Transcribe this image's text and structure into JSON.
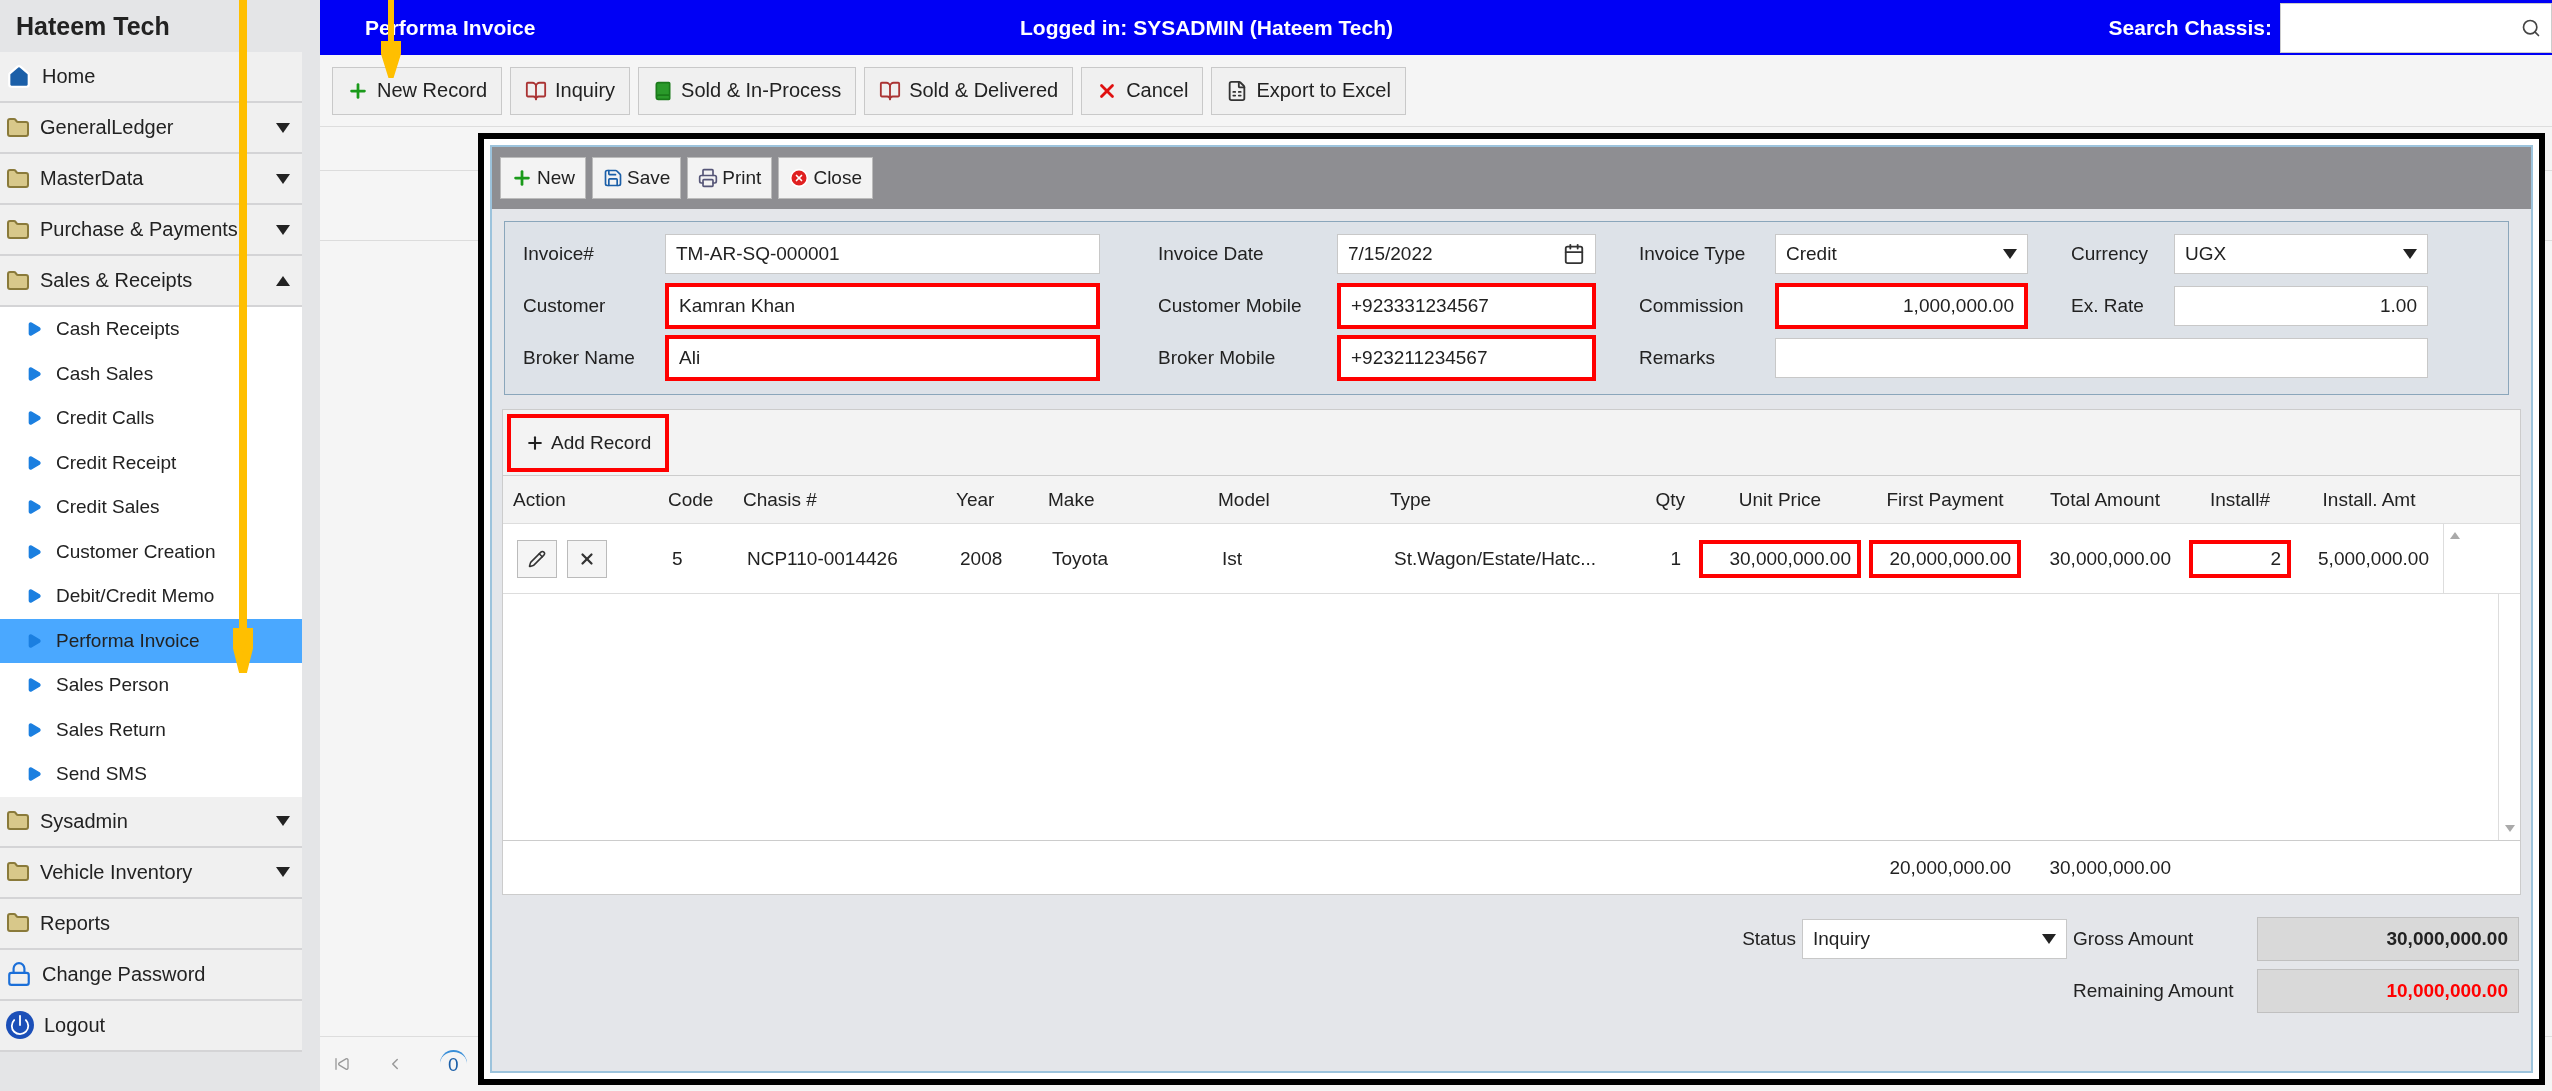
{
  "sidebar": {
    "title": "Hateem Tech",
    "items": [
      {
        "label": "Home",
        "kind": "home"
      },
      {
        "label": "GeneralLedger",
        "kind": "group",
        "expanded": false
      },
      {
        "label": "MasterData",
        "kind": "group",
        "expanded": false
      },
      {
        "label": "Purchase & Payments",
        "kind": "group",
        "expanded": false
      },
      {
        "label": "Sales & Receipts",
        "kind": "group",
        "expanded": true,
        "children": [
          {
            "label": "Cash Receipts",
            "selected": false
          },
          {
            "label": "Cash Sales",
            "selected": false
          },
          {
            "label": "Credit Calls",
            "selected": false
          },
          {
            "label": "Credit Receipt",
            "selected": false
          },
          {
            "label": "Credit Sales",
            "selected": false
          },
          {
            "label": "Customer Creation",
            "selected": false
          },
          {
            "label": "Debit/Credit Memo",
            "selected": false
          },
          {
            "label": "Performa Invoice",
            "selected": true
          },
          {
            "label": "Sales Person",
            "selected": false
          },
          {
            "label": "Sales Return",
            "selected": false
          },
          {
            "label": "Send SMS",
            "selected": false
          }
        ]
      },
      {
        "label": "Sysadmin",
        "kind": "group",
        "expanded": false
      },
      {
        "label": "Vehicle Inventory",
        "kind": "group",
        "expanded": false
      },
      {
        "label": "Reports",
        "kind": "folder"
      },
      {
        "label": "Change Password",
        "kind": "lock"
      },
      {
        "label": "Logout",
        "kind": "power"
      }
    ]
  },
  "header": {
    "title": "Performa Invoice",
    "logged_in": "Logged in: SYSADMIN (Hateem Tech)",
    "search_label": "Search Chassis:"
  },
  "toolbar": [
    {
      "label": "New Record"
    },
    {
      "label": "Inquiry"
    },
    {
      "label": "Sold & In-Process"
    },
    {
      "label": "Sold & Delivered"
    },
    {
      "label": "Cancel"
    },
    {
      "label": "Export to Excel"
    }
  ],
  "pager": {
    "page": "0"
  },
  "dialog": {
    "toolbar": [
      {
        "label": "New"
      },
      {
        "label": "Save"
      },
      {
        "label": "Print"
      },
      {
        "label": "Close"
      }
    ],
    "form": [
      [
        {
          "label": "Invoice#",
          "value": "TM-AR-SQ-000001",
          "kind": "text",
          "highlighted": false
        },
        {
          "label": "Invoice Date",
          "value": "7/15/2022",
          "kind": "date",
          "highlighted": false
        },
        {
          "label": "Invoice Type",
          "value": "Credit",
          "kind": "select",
          "highlighted": false
        },
        {
          "label": "Currency",
          "value": "UGX",
          "kind": "select",
          "highlighted": false
        }
      ],
      [
        {
          "label": "Customer",
          "value": "Kamran Khan",
          "kind": "text",
          "highlighted": true
        },
        {
          "label": "Customer Mobile",
          "value": "+923331234567",
          "kind": "text",
          "highlighted": true
        },
        {
          "label": "Commission",
          "value": "1,000,000.00",
          "kind": "number",
          "highlighted": true
        },
        {
          "label": "Ex. Rate",
          "value": "1.00",
          "kind": "number",
          "highlighted": false
        }
      ],
      [
        {
          "label": "Broker Name",
          "value": "Ali",
          "kind": "text",
          "highlighted": true
        },
        {
          "label": "Broker Mobile",
          "value": "+923211234567",
          "kind": "text",
          "highlighted": true
        },
        {
          "label": "Remarks",
          "kind": "text",
          "highlighted": false
        }
      ]
    ],
    "add_button": {
      "label": "Add Record",
      "highlighted": true
    },
    "grid": {
      "columns": [
        {
          "label": "Action"
        },
        {
          "label": "Code"
        },
        {
          "label": "Chasis #"
        },
        {
          "label": "Year"
        },
        {
          "label": "Make"
        },
        {
          "label": "Model"
        },
        {
          "label": "Type"
        },
        {
          "label": "Qty"
        },
        {
          "label": "Unit Price"
        },
        {
          "label": "First Payment",
          "total": "20,000,000.00"
        },
        {
          "label": "Total Amount",
          "total": "30,000,000.00"
        },
        {
          "label": "Install#"
        },
        {
          "label": "Install. Amt"
        }
      ],
      "rows": [
        {
          "cells": [
            {
              "kind": "actions"
            },
            {
              "value": "5",
              "highlighted": false
            },
            {
              "value": "NCP110-0014426",
              "highlighted": false
            },
            {
              "value": "2008",
              "highlighted": false
            },
            {
              "value": "Toyota",
              "highlighted": false
            },
            {
              "value": "Ist",
              "highlighted": false
            },
            {
              "value": "St.Wagon/Estate/Hatc...",
              "highlighted": false
            },
            {
              "value": "1",
              "highlighted": false
            },
            {
              "value": "30,000,000.00",
              "highlighted": true
            },
            {
              "value": "20,000,000.00",
              "highlighted": true
            },
            {
              "value": "30,000,000.00",
              "highlighted": false
            },
            {
              "value": "2",
              "highlighted": true
            },
            {
              "value": "5,000,000.00",
              "highlighted": false
            }
          ]
        }
      ]
    },
    "status": {
      "label": "Status",
      "value": "Inquiry"
    },
    "amounts": [
      {
        "label": "Gross Amount",
        "value": "30,000,000.00",
        "color": "#222222"
      },
      {
        "label": "Remaining Amount",
        "value": "10,000,000.00",
        "color": "#ff0000"
      }
    ]
  }
}
